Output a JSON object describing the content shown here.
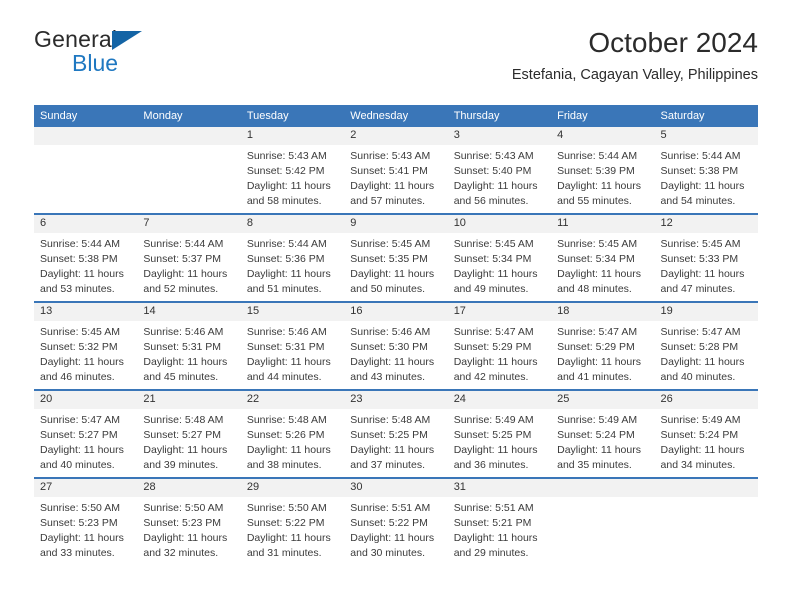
{
  "brand": {
    "word_one": "General",
    "word_two": "Blue",
    "triangle_icon": "blue-triangle-logo-mark",
    "accent_color": "#1464a5",
    "blue_text_color": "#1f78c1"
  },
  "header": {
    "title": "October 2024",
    "subtitle": "Estefania, Cagayan Valley, Philippines"
  },
  "theme": {
    "header_blue": "#3a76b8",
    "daynum_band": "#f2f2f2",
    "text": "#3b3b3b"
  },
  "calendar": {
    "weekday_headers": [
      "Sunday",
      "Monday",
      "Tuesday",
      "Wednesday",
      "Thursday",
      "Friday",
      "Saturday"
    ],
    "weeks": [
      [
        {
          "day": ""
        },
        {
          "day": ""
        },
        {
          "day": "1",
          "sunrise": "Sunrise: 5:43 AM",
          "sunset": "Sunset: 5:42 PM",
          "daylight_line1": "Daylight: 11 hours",
          "daylight_line2": "and 58 minutes."
        },
        {
          "day": "2",
          "sunrise": "Sunrise: 5:43 AM",
          "sunset": "Sunset: 5:41 PM",
          "daylight_line1": "Daylight: 11 hours",
          "daylight_line2": "and 57 minutes."
        },
        {
          "day": "3",
          "sunrise": "Sunrise: 5:43 AM",
          "sunset": "Sunset: 5:40 PM",
          "daylight_line1": "Daylight: 11 hours",
          "daylight_line2": "and 56 minutes."
        },
        {
          "day": "4",
          "sunrise": "Sunrise: 5:44 AM",
          "sunset": "Sunset: 5:39 PM",
          "daylight_line1": "Daylight: 11 hours",
          "daylight_line2": "and 55 minutes."
        },
        {
          "day": "5",
          "sunrise": "Sunrise: 5:44 AM",
          "sunset": "Sunset: 5:38 PM",
          "daylight_line1": "Daylight: 11 hours",
          "daylight_line2": "and 54 minutes."
        }
      ],
      [
        {
          "day": "6",
          "sunrise": "Sunrise: 5:44 AM",
          "sunset": "Sunset: 5:38 PM",
          "daylight_line1": "Daylight: 11 hours",
          "daylight_line2": "and 53 minutes."
        },
        {
          "day": "7",
          "sunrise": "Sunrise: 5:44 AM",
          "sunset": "Sunset: 5:37 PM",
          "daylight_line1": "Daylight: 11 hours",
          "daylight_line2": "and 52 minutes."
        },
        {
          "day": "8",
          "sunrise": "Sunrise: 5:44 AM",
          "sunset": "Sunset: 5:36 PM",
          "daylight_line1": "Daylight: 11 hours",
          "daylight_line2": "and 51 minutes."
        },
        {
          "day": "9",
          "sunrise": "Sunrise: 5:45 AM",
          "sunset": "Sunset: 5:35 PM",
          "daylight_line1": "Daylight: 11 hours",
          "daylight_line2": "and 50 minutes."
        },
        {
          "day": "10",
          "sunrise": "Sunrise: 5:45 AM",
          "sunset": "Sunset: 5:34 PM",
          "daylight_line1": "Daylight: 11 hours",
          "daylight_line2": "and 49 minutes."
        },
        {
          "day": "11",
          "sunrise": "Sunrise: 5:45 AM",
          "sunset": "Sunset: 5:34 PM",
          "daylight_line1": "Daylight: 11 hours",
          "daylight_line2": "and 48 minutes."
        },
        {
          "day": "12",
          "sunrise": "Sunrise: 5:45 AM",
          "sunset": "Sunset: 5:33 PM",
          "daylight_line1": "Daylight: 11 hours",
          "daylight_line2": "and 47 minutes."
        }
      ],
      [
        {
          "day": "13",
          "sunrise": "Sunrise: 5:45 AM",
          "sunset": "Sunset: 5:32 PM",
          "daylight_line1": "Daylight: 11 hours",
          "daylight_line2": "and 46 minutes."
        },
        {
          "day": "14",
          "sunrise": "Sunrise: 5:46 AM",
          "sunset": "Sunset: 5:31 PM",
          "daylight_line1": "Daylight: 11 hours",
          "daylight_line2": "and 45 minutes."
        },
        {
          "day": "15",
          "sunrise": "Sunrise: 5:46 AM",
          "sunset": "Sunset: 5:31 PM",
          "daylight_line1": "Daylight: 11 hours",
          "daylight_line2": "and 44 minutes."
        },
        {
          "day": "16",
          "sunrise": "Sunrise: 5:46 AM",
          "sunset": "Sunset: 5:30 PM",
          "daylight_line1": "Daylight: 11 hours",
          "daylight_line2": "and 43 minutes."
        },
        {
          "day": "17",
          "sunrise": "Sunrise: 5:47 AM",
          "sunset": "Sunset: 5:29 PM",
          "daylight_line1": "Daylight: 11 hours",
          "daylight_line2": "and 42 minutes."
        },
        {
          "day": "18",
          "sunrise": "Sunrise: 5:47 AM",
          "sunset": "Sunset: 5:29 PM",
          "daylight_line1": "Daylight: 11 hours",
          "daylight_line2": "and 41 minutes."
        },
        {
          "day": "19",
          "sunrise": "Sunrise: 5:47 AM",
          "sunset": "Sunset: 5:28 PM",
          "daylight_line1": "Daylight: 11 hours",
          "daylight_line2": "and 40 minutes."
        }
      ],
      [
        {
          "day": "20",
          "sunrise": "Sunrise: 5:47 AM",
          "sunset": "Sunset: 5:27 PM",
          "daylight_line1": "Daylight: 11 hours",
          "daylight_line2": "and 40 minutes."
        },
        {
          "day": "21",
          "sunrise": "Sunrise: 5:48 AM",
          "sunset": "Sunset: 5:27 PM",
          "daylight_line1": "Daylight: 11 hours",
          "daylight_line2": "and 39 minutes."
        },
        {
          "day": "22",
          "sunrise": "Sunrise: 5:48 AM",
          "sunset": "Sunset: 5:26 PM",
          "daylight_line1": "Daylight: 11 hours",
          "daylight_line2": "and 38 minutes."
        },
        {
          "day": "23",
          "sunrise": "Sunrise: 5:48 AM",
          "sunset": "Sunset: 5:25 PM",
          "daylight_line1": "Daylight: 11 hours",
          "daylight_line2": "and 37 minutes."
        },
        {
          "day": "24",
          "sunrise": "Sunrise: 5:49 AM",
          "sunset": "Sunset: 5:25 PM",
          "daylight_line1": "Daylight: 11 hours",
          "daylight_line2": "and 36 minutes."
        },
        {
          "day": "25",
          "sunrise": "Sunrise: 5:49 AM",
          "sunset": "Sunset: 5:24 PM",
          "daylight_line1": "Daylight: 11 hours",
          "daylight_line2": "and 35 minutes."
        },
        {
          "day": "26",
          "sunrise": "Sunrise: 5:49 AM",
          "sunset": "Sunset: 5:24 PM",
          "daylight_line1": "Daylight: 11 hours",
          "daylight_line2": "and 34 minutes."
        }
      ],
      [
        {
          "day": "27",
          "sunrise": "Sunrise: 5:50 AM",
          "sunset": "Sunset: 5:23 PM",
          "daylight_line1": "Daylight: 11 hours",
          "daylight_line2": "and 33 minutes."
        },
        {
          "day": "28",
          "sunrise": "Sunrise: 5:50 AM",
          "sunset": "Sunset: 5:23 PM",
          "daylight_line1": "Daylight: 11 hours",
          "daylight_line2": "and 32 minutes."
        },
        {
          "day": "29",
          "sunrise": "Sunrise: 5:50 AM",
          "sunset": "Sunset: 5:22 PM",
          "daylight_line1": "Daylight: 11 hours",
          "daylight_line2": "and 31 minutes."
        },
        {
          "day": "30",
          "sunrise": "Sunrise: 5:51 AM",
          "sunset": "Sunset: 5:22 PM",
          "daylight_line1": "Daylight: 11 hours",
          "daylight_line2": "and 30 minutes."
        },
        {
          "day": "31",
          "sunrise": "Sunrise: 5:51 AM",
          "sunset": "Sunset: 5:21 PM",
          "daylight_line1": "Daylight: 11 hours",
          "daylight_line2": "and 29 minutes."
        },
        {
          "day": ""
        },
        {
          "day": ""
        }
      ]
    ]
  }
}
